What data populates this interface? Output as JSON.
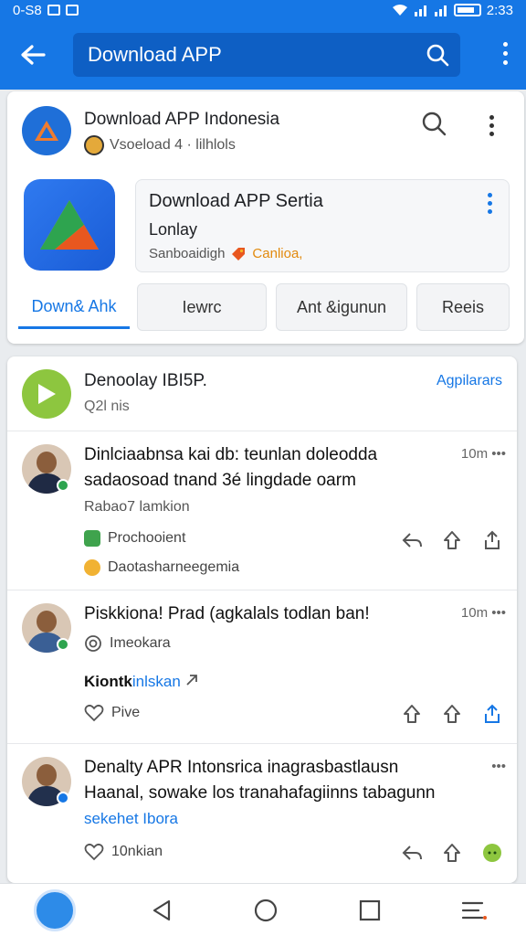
{
  "status_bar": {
    "left_text": "0-S8",
    "time": "2:33"
  },
  "app_bar": {
    "search_value": "Download APP"
  },
  "header": {
    "title": "Download APP Indonesia",
    "subtitle": "Vsoeload 4 · lilhlols",
    "promo": {
      "title": "Download APP Sertia",
      "line2": "Lonlay",
      "meta_left": "Sanboaidigh",
      "meta_highlight": "Canlioa,"
    },
    "tabs": [
      {
        "label": "Down& Ahk"
      },
      {
        "label": "Iewrc"
      },
      {
        "label": "Ant &igunun"
      },
      {
        "label": "Reeis"
      }
    ]
  },
  "feed": {
    "title": "Denoolay IBI5P.",
    "subtitle": "Q2l nis",
    "action_label": "Agpilarars",
    "posts": [
      {
        "time": "10m •••",
        "text_line1": "Dinlciaabnsa kai db: teunlan doleodda",
        "text_line2": "sadaosoad tnand 3é lingdade oarm",
        "meta": "Rabao7 lamkion",
        "row1": "Prochooient",
        "row2": "Daotasharneegemia"
      },
      {
        "time": "10m •••",
        "text_line1": "Piskkiona! Prad (agkalals todlan ban!",
        "meta": "Imeokara",
        "bold_part": "Kiontk",
        "link_part": "inlskan",
        "like_label": "Pive"
      },
      {
        "time": "•••",
        "text_line1": "Denalty APR Intonsrica inagrasbastlausn",
        "text_line2": "Haanal, sowake los tranahafagiinns tabagunn",
        "link_text": "sekehet Ibora",
        "like_label": "10nkian"
      }
    ]
  },
  "colors": {
    "primary": "#1677e5",
    "green": "#8dc63f",
    "online": "#2ea44f"
  }
}
